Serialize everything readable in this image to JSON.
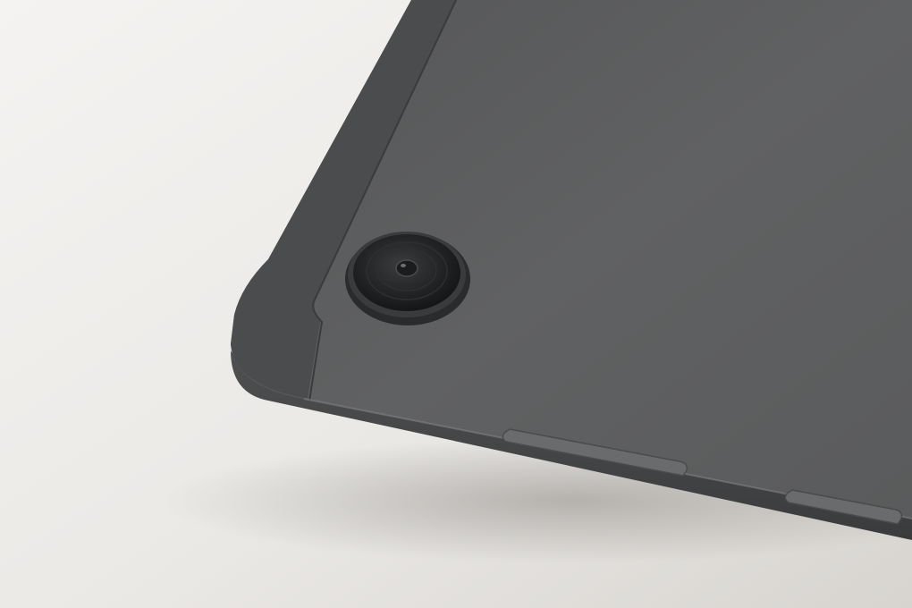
{
  "photo": {
    "subject": "",
    "colors": {
      "surface_light": "#f3f1ef",
      "surface_shadow": "#a09d9a",
      "body_main": "#5f6061",
      "body_dark": "#3f4041",
      "body_edge": "#4a4b4c",
      "lens_ring": "#2a2b2c",
      "lens_glass": "#1a1b1c",
      "button": "#6a6b6c"
    },
    "elements": {
      "tablet_body": "tablet-back",
      "antenna_line": "antenna-band",
      "camera": "camera-lens-icon",
      "volume_button": "volume-button",
      "power_button": "power-button"
    }
  }
}
